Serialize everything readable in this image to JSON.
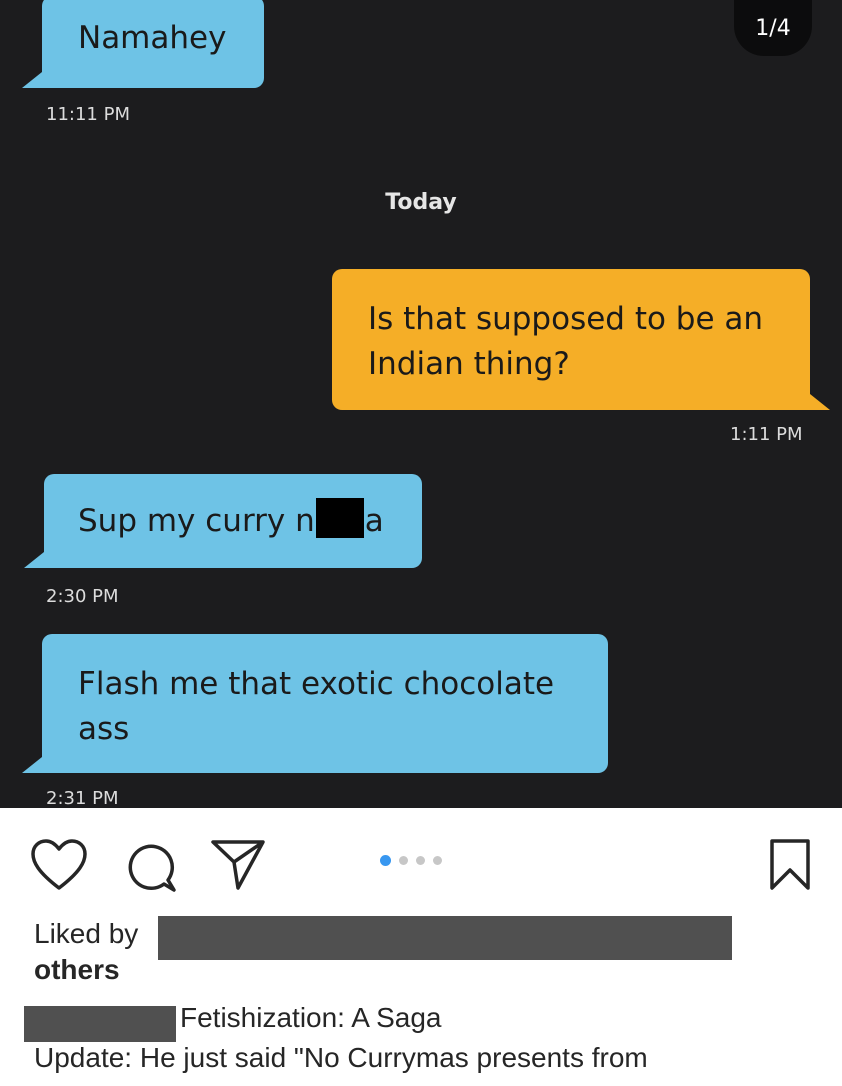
{
  "post": {
    "carousel_counter": "1/4",
    "carousel_total": 4,
    "carousel_active_index": 0
  },
  "chat": {
    "messages": [
      {
        "direction": "incoming",
        "text": "Namahey",
        "time": "11:11 PM"
      },
      {
        "direction": "outgoing",
        "text": "Is that supposed to be an Indian thing?",
        "time": "1:11 PM"
      },
      {
        "direction": "incoming",
        "text_before": "Sup my curry n",
        "text_after": "a",
        "time": "2:30 PM"
      },
      {
        "direction": "incoming",
        "text": "Flash me that exotic chocolate ass",
        "time": "2:31 PM"
      }
    ],
    "day_separator": "Today",
    "colors": {
      "background": "#1c1c1e",
      "incoming_bubble": "#6ec3e6",
      "outgoing_bubble": "#f5ae27"
    }
  },
  "actions": {
    "icons": [
      "heart-icon",
      "comment-icon",
      "share-icon",
      "bookmark-icon"
    ],
    "active_dot_color": "#3897f0"
  },
  "caption": {
    "liked_by_prefix": "Liked by",
    "liked_by_suffix": "others",
    "title": "Fetishization: A Saga",
    "update": "Update: He just said \"No Currymas presents from"
  }
}
